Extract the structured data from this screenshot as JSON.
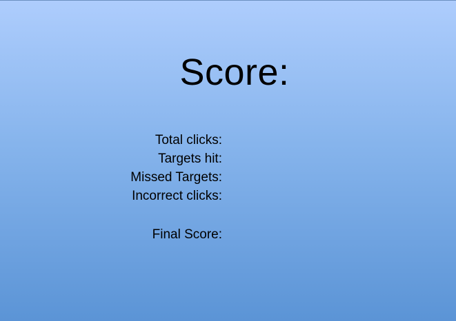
{
  "scoreScreen": {
    "title": "Score:",
    "labels": {
      "total_clicks": "Total clicks:",
      "targets_hit": "Targets hit:",
      "missed_targets": "Missed Targets:",
      "incorrect_clicks": "Incorrect clicks:",
      "final_score": "Final Score:"
    },
    "colors": {
      "background_top": "#aecdfd",
      "background_bottom": "#5b94d6",
      "text": "#000000"
    }
  }
}
